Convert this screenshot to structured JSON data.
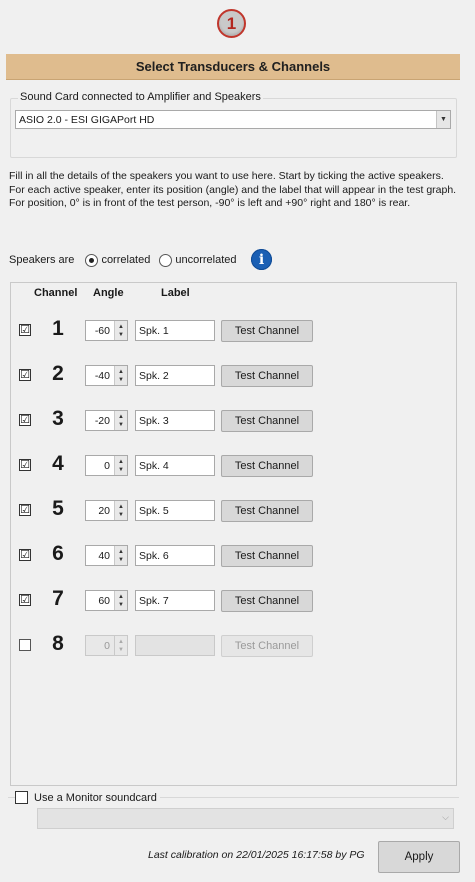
{
  "step_number": "1",
  "section_title": "Select Transducers & Channels",
  "sound_card": {
    "label": "Sound Card connected to Amplifier and Speakers",
    "selected": "ASIO 2.0 - ESI GIGAPort HD"
  },
  "description": "Fill in all the details of the speakers you want to use here.  Start by ticking the active speakers.  For each active speaker, enter its position (angle) and the label that will appear in the test graph. For position, 0° is in front of the test person, -90° is left and +90° right and 180° is rear.",
  "correlation": {
    "label": "Speakers are",
    "options": [
      "correlated",
      "uncorrelated"
    ],
    "selected": "correlated",
    "info_icon": "i"
  },
  "table": {
    "headers": {
      "channel": "Channel",
      "angle": "Angle",
      "label": "Label"
    },
    "test_button_label": "Test Channel",
    "rows": [
      {
        "checked": true,
        "check_glyph": "☑",
        "channel": "1",
        "angle": "-60",
        "label": "Spk. 1",
        "enabled": true
      },
      {
        "checked": true,
        "check_glyph": "☑",
        "channel": "2",
        "angle": "-40",
        "label": "Spk. 2",
        "enabled": true
      },
      {
        "checked": true,
        "check_glyph": "☑",
        "channel": "3",
        "angle": "-20",
        "label": "Spk. 3",
        "enabled": true
      },
      {
        "checked": true,
        "check_glyph": "☑",
        "channel": "4",
        "angle": "0",
        "label": "Spk. 4",
        "enabled": true
      },
      {
        "checked": true,
        "check_glyph": "☑",
        "channel": "5",
        "angle": "20",
        "label": "Spk. 5",
        "enabled": true
      },
      {
        "checked": true,
        "check_glyph": "☑",
        "channel": "6",
        "angle": "40",
        "label": "Spk. 6",
        "enabled": true
      },
      {
        "checked": true,
        "check_glyph": "☑",
        "channel": "7",
        "angle": "60",
        "label": "Spk. 7",
        "enabled": true
      },
      {
        "checked": false,
        "check_glyph": "",
        "channel": "8",
        "angle": "0",
        "label": "",
        "enabled": false
      }
    ]
  },
  "monitor": {
    "label": "Use a Monitor soundcard",
    "checked": false,
    "selected": ""
  },
  "calibration_text": "Last calibration on 22/01/2025 16:17:58 by PG",
  "apply_label": "Apply",
  "colors": {
    "header_bg": "#dfbc8e",
    "badge_ring": "#c0362c",
    "info_blue": "#1a5fb4"
  }
}
